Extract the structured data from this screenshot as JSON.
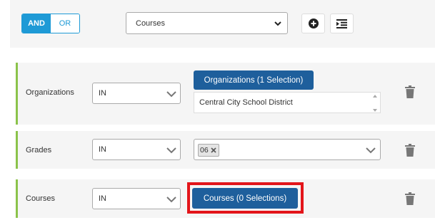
{
  "toolbar": {
    "and_label": "AND",
    "or_label": "OR",
    "field_select_value": "Courses"
  },
  "rules": [
    {
      "label": "Organizations",
      "operator": "IN",
      "button_label": "Organizations (1 Selection)",
      "text_value": "Central City School District"
    },
    {
      "label": "Grades",
      "operator": "IN",
      "tag_value": "06"
    },
    {
      "label": "Courses",
      "operator": "IN",
      "button_label": "Courses (0 Selections)"
    }
  ],
  "colors": {
    "accent": "#1e9ad6",
    "button": "#1e5f9c",
    "rule_border": "#8bc34a",
    "highlight": "#e3151a"
  },
  "icons": [
    "chevron-down-icon",
    "plus-circle-icon",
    "indent-icon",
    "trash-icon",
    "close-icon",
    "scroll-up-icon",
    "scroll-down-icon"
  ]
}
